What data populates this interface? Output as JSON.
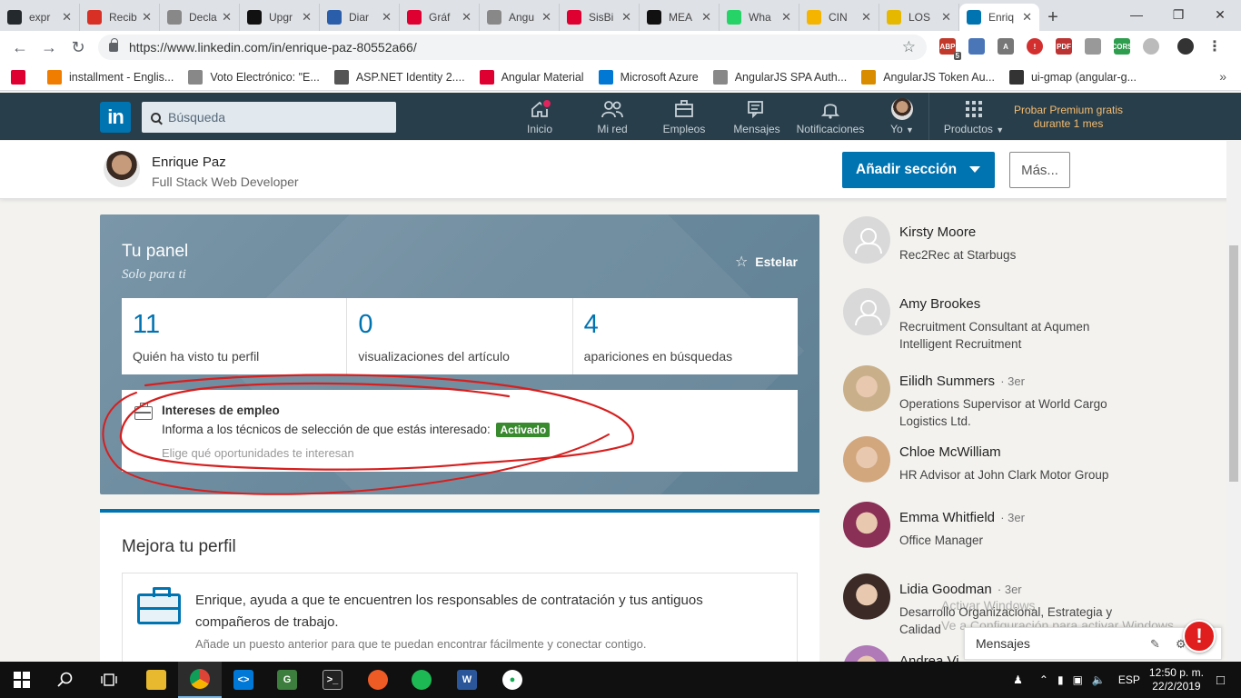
{
  "browser": {
    "tabs": [
      {
        "title": "expr",
        "icon": "github-icon",
        "color": "#24292e"
      },
      {
        "title": "Recib",
        "icon": "gmail-icon",
        "color": "#d93025"
      },
      {
        "title": "Decla",
        "icon": "page-icon",
        "color": "#888888"
      },
      {
        "title": "Upgr",
        "icon": "medium-icon",
        "color": "#111111"
      },
      {
        "title": "Diar",
        "icon": "dp-icon",
        "color": "#2a5daa"
      },
      {
        "title": "Gráf",
        "icon": "angular-icon",
        "color": "#dd0031"
      },
      {
        "title": "Angu",
        "icon": "page-icon",
        "color": "#888888"
      },
      {
        "title": "SisBi",
        "icon": "angular-icon",
        "color": "#dd0031"
      },
      {
        "title": "MEA",
        "icon": "medium-icon",
        "color": "#111111"
      },
      {
        "title": "Wha",
        "icon": "whatsapp-icon",
        "color": "#25d366"
      },
      {
        "title": "CIN",
        "icon": "drive-icon",
        "color": "#f4b400"
      },
      {
        "title": "LOS",
        "icon": "coin-icon",
        "color": "#e6b800"
      },
      {
        "title": "Enriq",
        "icon": "linkedin-icon",
        "color": "#0073b1",
        "active": true
      }
    ],
    "url": "https://www.linkedin.com/in/enrique-paz-80552a66/",
    "bookmarks": [
      {
        "label": "",
        "icon": "angular-icon",
        "color": "#dd0031"
      },
      {
        "label": "installment - Englis...",
        "icon": "wr-icon",
        "color": "#f07c00"
      },
      {
        "label": "Voto Electrónico: \"E...",
        "icon": "page-icon",
        "color": "#888888"
      },
      {
        "label": "ASP.NET Identity 2....",
        "icon": "aspnet-icon",
        "color": "#555555"
      },
      {
        "label": "Angular Material",
        "icon": "angular-icon",
        "color": "#dd0031"
      },
      {
        "label": "Microsoft Azure",
        "icon": "microsoft-icon",
        "color": "#0078d4"
      },
      {
        "label": "AngularJS SPA Auth...",
        "icon": "page-icon",
        "color": "#888888"
      },
      {
        "label": "AngularJS Token Au...",
        "icon": "token-icon",
        "color": "#d98c00"
      },
      {
        "label": "ui-gmap (angular-g...",
        "icon": "download-icon",
        "color": "#333333"
      }
    ],
    "ext_badge": "5"
  },
  "linkedin": {
    "logo": "in",
    "search_placeholder": "Búsqueda",
    "nav": [
      {
        "label": "Inicio",
        "icon": "home-icon"
      },
      {
        "label": "Mi red",
        "icon": "network-icon"
      },
      {
        "label": "Empleos",
        "icon": "jobs-icon"
      },
      {
        "label": "Mensajes",
        "icon": "messages-icon"
      },
      {
        "label": "Notificaciones",
        "icon": "bell-icon"
      },
      {
        "label": "Yo",
        "icon": "me-avatar"
      },
      {
        "label": "Productos",
        "icon": "grid-icon"
      }
    ],
    "premium": "Probar Premium gratis durante 1 mes"
  },
  "profile": {
    "name": "Enrique Paz",
    "headline": "Full Stack Web Developer",
    "add_section": "Añadir sección",
    "more": "Más..."
  },
  "panel": {
    "title": "Tu panel",
    "subtitle": "Solo para ti",
    "star_label": "Estelar",
    "stats": [
      {
        "value": "11",
        "label": "Quién ha visto tu perfil"
      },
      {
        "value": "0",
        "label": "visualizaciones del artículo"
      },
      {
        "value": "4",
        "label": "apariciones en búsquedas"
      }
    ],
    "interests": {
      "title": "Intereses de empleo",
      "desc": "Informa a los técnicos de selección de que estás interesado:",
      "badge": "Activado",
      "link": "Elige qué oportunidades te interesan"
    }
  },
  "improve": {
    "title": "Mejora tu perfil",
    "text": "Enrique, ayuda a que te encuentren los responsables de contratación y tus antiguos compañeros de trabajo.",
    "sub": "Añade un puesto anterior para que te puedan encontrar fácilmente y conectar contigo."
  },
  "people": [
    {
      "name": "Kirsty Moore",
      "degree": "",
      "headline": "Rec2Rec at Starbugs",
      "avatar": "ghost"
    },
    {
      "name": "Amy Brookes",
      "degree": "",
      "headline": "Recruitment Consultant at Aqumen Intelligent Recruitment",
      "avatar": "ghost"
    },
    {
      "name": "Eilidh Summers",
      "degree": "· 3er",
      "headline": "Operations Supervisor at World Cargo Logistics Ltd.",
      "avatar": "photo",
      "color": "#c9b08a"
    },
    {
      "name": "Chloe McWilliam",
      "degree": "",
      "headline": "HR Advisor at John Clark Motor Group",
      "avatar": "photo",
      "color": "#d2a77e"
    },
    {
      "name": "Emma Whitfield",
      "degree": "· 3er",
      "headline": "Office Manager",
      "avatar": "photo",
      "color": "#8a2f55"
    },
    {
      "name": "Lidia Goodman",
      "degree": "· 3er",
      "headline": "Desarrollo Organizacional, Estrategia y Calidad",
      "avatar": "photo",
      "color": "#3b2a25"
    },
    {
      "name": "Andrea Vi",
      "degree": "",
      "headline": "",
      "avatar": "photo",
      "color": "#b07ab8"
    }
  ],
  "messages_bar": "Mensajes",
  "watermark": {
    "line1": "Activar Windows",
    "line2": "Ve a Configuración para activar Windows."
  },
  "taskbar": {
    "lang": "ESP",
    "time": "12:50 p. m.",
    "date": "22/2/2019"
  }
}
